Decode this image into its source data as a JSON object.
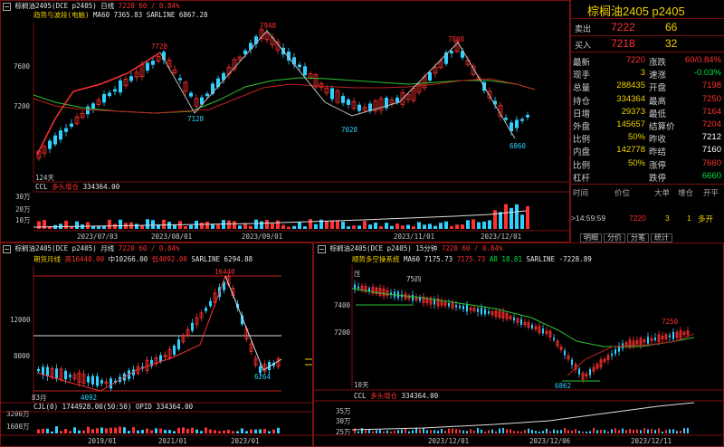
{
  "main": {
    "header": {
      "name": "棕榈油2405(DCE p2405)",
      "period": "日线",
      "price": "7220",
      "change": "60 / 0.84%"
    },
    "indicator": {
      "name": "趋势与波段(电脑)",
      "ma60": "MA60 7365.83",
      "sarline": "SARLINE 6867.28"
    },
    "y_labels": [
      "7600",
      "7200"
    ],
    "peaks": [
      "7728",
      "7948",
      "7128",
      "7028",
      "7808",
      "6860"
    ],
    "days_label": "124天",
    "vol": {
      "name": "CCL",
      "ind": "多头增仓",
      "value": "334364.00",
      "y_labels": [
        "30万",
        "20万",
        "10万"
      ]
    },
    "x_labels": [
      "2023/07/03",
      "2023/08/01",
      "2023/09/01",
      "2023/11/01",
      "2023/12/01"
    ]
  },
  "quote": {
    "title": "棕榈油2405 p2405",
    "sell": {
      "label": "卖出",
      "price": "7222",
      "qty": "66"
    },
    "buy": {
      "label": "买入",
      "price": "7218",
      "qty": "32"
    },
    "rows": [
      {
        "l1": "最新",
        "v1": "7220",
        "l2": "涨跌",
        "v2": "60/0.84%"
      },
      {
        "l1": "现手",
        "v1": "3",
        "l2": "速涨",
        "v2": "-0.03%"
      },
      {
        "l1": "总量",
        "v1": "288435",
        "l2": "开盘",
        "v2": "7198"
      },
      {
        "l1": "持仓",
        "v1": "334364",
        "l2": "最高",
        "v2": "7250"
      },
      {
        "l1": "日增",
        "v1": "29373",
        "l2": "最低",
        "v2": "7164"
      },
      {
        "l1": "外盘",
        "v1": "145657",
        "l2": "结算价",
        "v2": "7204"
      },
      {
        "l1": "比例",
        "v1": "50%",
        "l2": "昨收",
        "v2": "7212"
      },
      {
        "l1": "内盘",
        "v1": "142778",
        "l2": "昨结",
        "v2": "7160"
      },
      {
        "l1": "比例",
        "v1": "50%",
        "l2": "涨停",
        "v2": "7660"
      },
      {
        "l1": "杠杆",
        "v1": "",
        "l2": "跌停",
        "v2": "6660"
      }
    ],
    "trade_headers": [
      "时间",
      "价位",
      "大单",
      "增仓",
      "开平"
    ],
    "trade": {
      "time": ">14:59:59",
      "price": "7220",
      "qty": "3",
      "oi": "1",
      "type": "多开"
    },
    "tabs": [
      "明细",
      "分价",
      "分笔",
      "统计"
    ]
  },
  "monthly": {
    "header": {
      "name": "棕榈油2405(DCE p2405)",
      "period": "月线",
      "price": "7220",
      "change": "60 / 0.84%"
    },
    "indicator": {
      "name": "期货月线",
      "high_label": "高",
      "high": "16440.00",
      "mid_label": "中",
      "mid": "10266.00",
      "low_label": "低",
      "low": "4092.00",
      "sarline": "SARLINE 6294.88"
    },
    "y_labels": [
      "12000",
      "8000"
    ],
    "peaks": [
      "16440",
      "4092",
      "6264"
    ],
    "bars_label": "83月",
    "vol": {
      "name": "CJL(0)",
      "value": "1744928.00(50:50)",
      "opid": "OPID 334364.00",
      "y_labels": [
        "3200万",
        "1600万"
      ]
    },
    "x_labels": [
      "2019/01",
      "2021/01",
      "2023/01"
    ]
  },
  "min15": {
    "header": {
      "name": "棕榈油2405(DCE p2405)",
      "period": "15分钟",
      "price": "7220",
      "change": "60 / 0.84%"
    },
    "indicator": {
      "name": "顺势多空操系统",
      "ma60": "MA60 7175.73",
      "v2": "7175.73",
      "a8": "A8 18.81",
      "sarline": "SARLINE -7228.89"
    },
    "y_labels": [
      "7400",
      "7200"
    ],
    "peaks": [
      "7250",
      "6862"
    ],
    "marks": [
      "压",
      "75四"
    ],
    "days_label": "10天",
    "vol": {
      "name": "CCL",
      "ind": "多头增仓",
      "value": "334364.00",
      "y_labels": [
        "35万",
        "30万",
        "25万"
      ]
    },
    "x_labels": [
      "2023/12/01",
      "2023/12/06",
      "2023/12/11"
    ]
  },
  "colors": {
    "up": "#ff3030",
    "down": "#30d0ff",
    "ma": "#30c030",
    "sar": "#d03030",
    "panel_border": "#7a1010"
  }
}
